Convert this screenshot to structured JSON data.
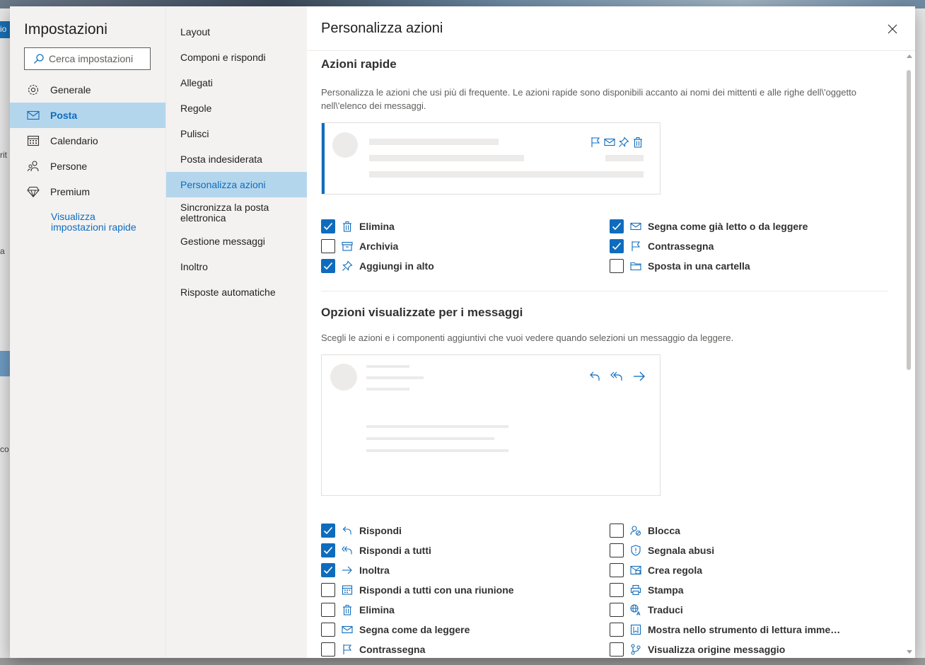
{
  "settings": {
    "title": "Impostazioni",
    "search_placeholder": "Cerca impostazioni",
    "nav": [
      {
        "label": "Generale",
        "icon": "gear-icon"
      },
      {
        "label": "Posta",
        "icon": "mail-icon"
      },
      {
        "label": "Calendario",
        "icon": "calendar-icon"
      },
      {
        "label": "Persone",
        "icon": "people-icon"
      },
      {
        "label": "Premium",
        "icon": "diamond-icon"
      }
    ],
    "quick_link": "Visualizza impostazioni rapide"
  },
  "mail_nav": [
    "Layout",
    "Componi e rispondi",
    "Allegati",
    "Regole",
    "Pulisci",
    "Posta indesiderata",
    "Personalizza azioni",
    "Sincronizza la posta elettronica",
    "Gestione messaggi",
    "Inoltro",
    "Risposte automatiche"
  ],
  "page": {
    "title": "Personalizza azioni",
    "quick_actions": {
      "title": "Azioni rapide",
      "description": "Personalizza le azioni che usi più di frequente. Le azioni rapide sono disponibili accanto ai nomi dei mittenti e alle righe dell\\'oggetto nell\\'elenco dei messaggi.",
      "left": [
        {
          "label": "Elimina",
          "checked": true,
          "icon": "trash-icon"
        },
        {
          "label": "Archivia",
          "checked": false,
          "icon": "archive-icon"
        },
        {
          "label": "Aggiungi in alto",
          "checked": true,
          "icon": "pin-icon"
        }
      ],
      "right": [
        {
          "label": "Segna come già letto o da leggere",
          "checked": true,
          "icon": "mail-icon"
        },
        {
          "label": "Contrassegna",
          "checked": true,
          "icon": "flag-icon"
        },
        {
          "label": "Sposta in una cartella",
          "checked": false,
          "icon": "folder-icon"
        }
      ]
    },
    "message_options": {
      "title": "Opzioni visualizzate per i messaggi",
      "description": "Scegli le azioni e i componenti aggiuntivi che vuoi vedere quando selezioni un messaggio da leggere.",
      "left": [
        {
          "label": "Rispondi",
          "checked": true,
          "icon": "reply-icon"
        },
        {
          "label": "Rispondi a tutti",
          "checked": true,
          "icon": "reply-all-icon"
        },
        {
          "label": "Inoltra",
          "checked": true,
          "icon": "forward-icon"
        },
        {
          "label": "Rispondi a tutti con una riunione",
          "checked": false,
          "icon": "calendar-icon"
        },
        {
          "label": "Elimina",
          "checked": false,
          "icon": "trash-icon"
        },
        {
          "label": "Segna come da leggere",
          "checked": false,
          "icon": "mail-icon"
        },
        {
          "label": "Contrassegna",
          "checked": false,
          "icon": "flag-icon"
        }
      ],
      "right": [
        {
          "label": "Blocca",
          "checked": false,
          "icon": "block-user-icon"
        },
        {
          "label": "Segnala abusi",
          "checked": false,
          "icon": "shield-icon"
        },
        {
          "label": "Crea regola",
          "checked": false,
          "icon": "rule-icon"
        },
        {
          "label": "Stampa",
          "checked": false,
          "icon": "print-icon"
        },
        {
          "label": "Traduci",
          "checked": false,
          "icon": "translate-icon"
        },
        {
          "label": "Mostra nello strumento di lettura imme…",
          "checked": false,
          "icon": "immersive-reader-icon"
        },
        {
          "label": "Visualizza origine messaggio",
          "checked": false,
          "icon": "source-icon"
        }
      ]
    }
  },
  "colors": {
    "accent": "#0f6cbd",
    "selected_bg": "#b4d6ed",
    "nav_bg": "#f3f2f1"
  },
  "background": {
    "fragments": [
      "io",
      "rit",
      "a",
      "co"
    ]
  }
}
